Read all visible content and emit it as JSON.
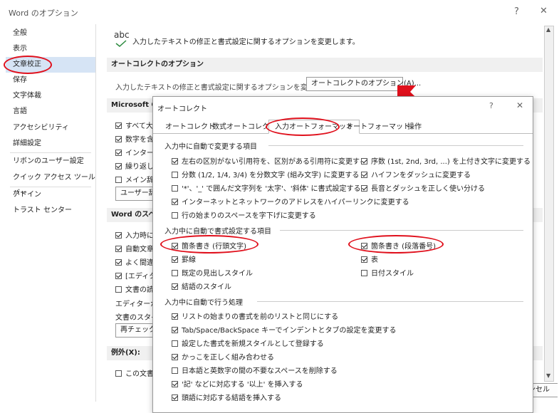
{
  "outer": {
    "title": "Word のオプション",
    "help": "?",
    "close": "✕",
    "sidebar": [
      "全般",
      "表示",
      "文章校正",
      "保存",
      "文字体裁",
      "言語",
      "アクセシビリティ",
      "詳細設定",
      "リボンのユーザー設定",
      "クイック アクセス ツール バー",
      "アドイン",
      "トラスト センター"
    ],
    "selected_nav": "文章校正",
    "main": {
      "abc_label": "abc",
      "intro": "入力したテキストの修正と書式設定に関するオプションを変更します。",
      "sec_autocorrect": "オートコレクトのオプション",
      "autocorrect_desc": "入力したテキストの修正と書式設定に関するオプションを変更します。",
      "autocorrect_button": "オートコレクトのオプション(A)...",
      "sec_office": "Microsoft O",
      "office_rows": [
        "すべて大文",
        "数字を含",
        "インターネ",
        "繰り返し",
        "メイン辞書"
      ],
      "user_dict_button": "ユーザー辞書",
      "sec_word": "Word のスペル",
      "word_rows": [
        "入力時に",
        "自動文章",
        "よく間違う",
        "[エディター",
        "文書の読"
      ],
      "editor_text": "エディターがチ",
      "style_text": "文書のスタイル",
      "recheck_button": "再チェック(K",
      "exceptions_label": "例外(X):",
      "last_row": "この文書の",
      "cancel_partial": "ンセル"
    }
  },
  "dialog": {
    "title": "オートコレクト",
    "help": "?",
    "close": "✕",
    "tabs": [
      "オートコレクト",
      "数式オートコレクト",
      "入力オートフォーマット",
      "オートフォーマット",
      "操作"
    ],
    "active_tab": "入力オートフォーマット",
    "group1": {
      "label": "入力中に自動で変更する項目",
      "left": [
        {
          "label": "左右の区別がない引用符を、区別がある引用符に変更する",
          "checked": true
        },
        {
          "label": "分数 (1/2, 1/4, 3/4) を分数文字 (組み文字) に変更する",
          "checked": false
        },
        {
          "label": "'*'、'_' で囲んだ文字列を '太字'、'斜体' に書式設定する",
          "checked": false
        },
        {
          "label": "インターネットとネットワークのアドレスをハイパーリンクに変更する",
          "checked": true
        },
        {
          "label": "行の始まりのスペースを字下げに変更する",
          "checked": false
        }
      ],
      "right": [
        {
          "label": "序数 (1st, 2nd, 3rd, ...) を上付き文字に変更する",
          "checked": true
        },
        {
          "label": "ハイフンをダッシュに変更する",
          "checked": true
        },
        {
          "label": "長音とダッシュを正しく使い分ける",
          "checked": true
        }
      ]
    },
    "group2": {
      "label": "入力中に自動で書式設定する項目",
      "left": [
        {
          "label": "箇条書き (行頭文字)",
          "checked": true
        },
        {
          "label": "罫線",
          "checked": true
        },
        {
          "label": "既定の見出しスタイル",
          "checked": false
        },
        {
          "label": "結語のスタイル",
          "checked": true
        }
      ],
      "right": [
        {
          "label": "箇条書き (段落番号)",
          "checked": true
        },
        {
          "label": "表",
          "checked": true
        },
        {
          "label": "日付スタイル",
          "checked": false
        }
      ]
    },
    "group3": {
      "label": "入力中に自動で行う処理",
      "items": [
        {
          "label": "リストの始まりの書式を前のリストと同じにする",
          "checked": true
        },
        {
          "label": "Tab/Space/BackSpace キーでインデントとタブの設定を変更する",
          "checked": true
        },
        {
          "label": "設定した書式を新規スタイルとして登録する",
          "checked": false
        },
        {
          "label": "かっこを正しく組み合わせる",
          "checked": true
        },
        {
          "label": "日本語と英数字の間の不要なスペースを削除する",
          "checked": false
        },
        {
          "label": "'記' などに対応する '以上' を挿入する",
          "checked": true
        },
        {
          "label": "頭語に対応する結語を挿入する",
          "checked": true
        }
      ]
    }
  },
  "colors": {
    "highlight": "#e0101c",
    "nav_selected": "#d6e4f5",
    "section_bg": "#f0f0f0"
  }
}
